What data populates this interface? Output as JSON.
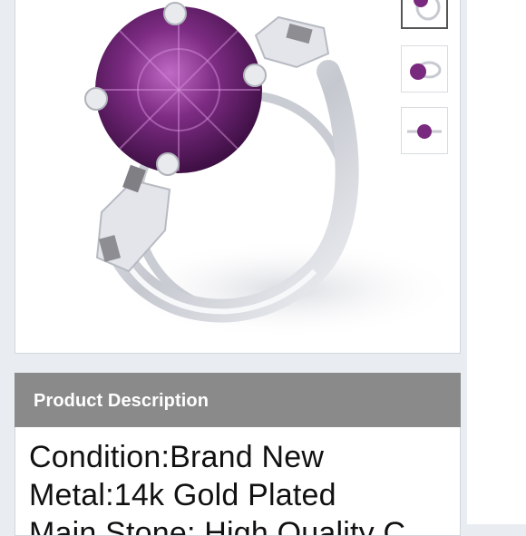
{
  "product": {
    "image_alt": "Purple round gemstone silver ring",
    "gem_color": "#7a2a7e",
    "metal_color": "#d9dbe0"
  },
  "thumbnails": [
    {
      "name": "thumbnail-ring-side",
      "active": true
    },
    {
      "name": "thumbnail-ring-top",
      "active": false
    },
    {
      "name": "thumbnail-ring-front",
      "active": false
    }
  ],
  "description": {
    "title": "Product Description",
    "lines": [
      "Condition:Brand New",
      "Metal:14k Gold Plated",
      "Main Stone: High Quality C"
    ]
  }
}
